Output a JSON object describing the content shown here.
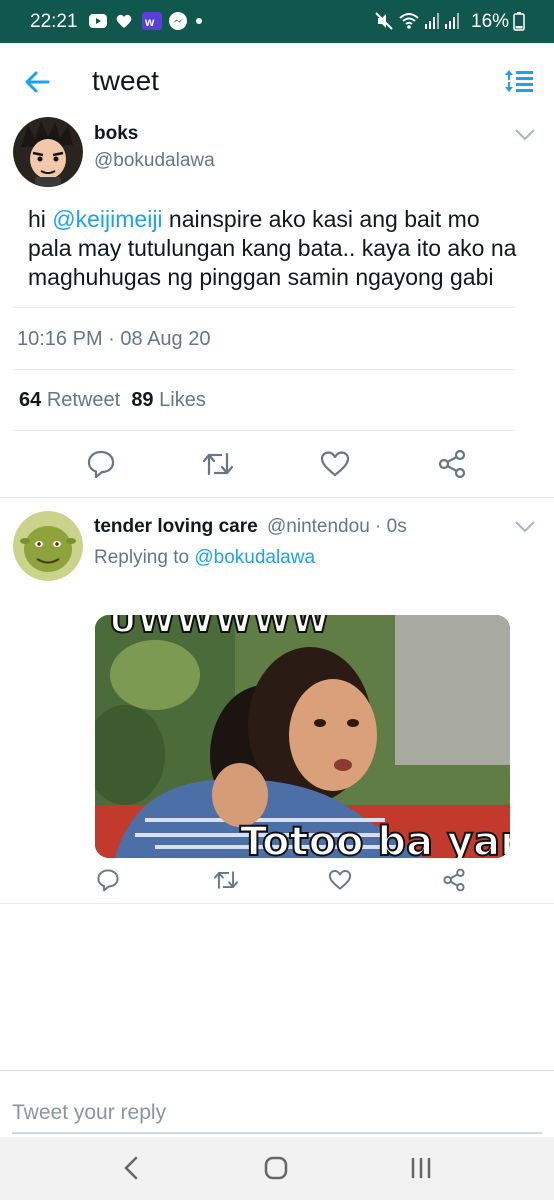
{
  "status_bar": {
    "time": "22:21",
    "battery": "16%",
    "bg_color": "#10574d"
  },
  "top_bar": {
    "back_icon": "arrow-left-icon",
    "title": "tweet",
    "sort_icon": "sort-icon"
  },
  "tweet": {
    "author_name": "boks",
    "author_handle": "@bokudalawa",
    "text_prefix": "hi ",
    "mention": "@keijimeiji",
    "text_rest": " nainspire ako kasi ang bait mo pala may tutulungan kang bata.. kaya ito ako na maghuhugas ng pinggan samin ngayong gabi",
    "timestamp": "10:16 PM · 08 Aug 20",
    "retweet_count": "64",
    "retweet_label": "Retweet",
    "likes_count": "89",
    "likes_label": "Likes"
  },
  "reply": {
    "author_name": "tender loving care",
    "author_handle": "@nintendou · 0s",
    "replying_prefix": "Replying to ",
    "replying_to": "@bokudalawa",
    "meme_top_text": "UWWWWW",
    "meme_bottom_text": "Totoo ba yan?"
  },
  "composer": {
    "placeholder": "Tweet your reply"
  },
  "colors": {
    "accent": "#1da1f2",
    "text": "#14171a",
    "muted": "#657786"
  }
}
